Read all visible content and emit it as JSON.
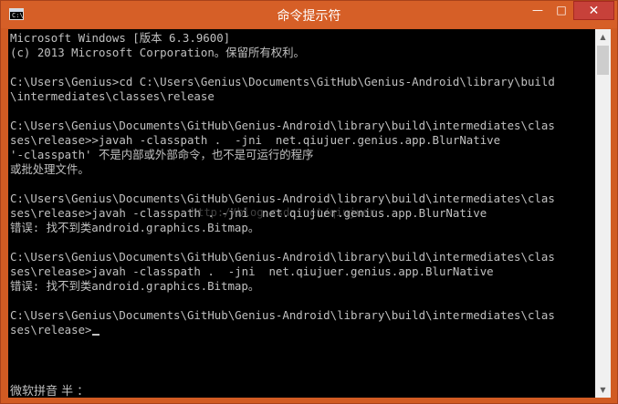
{
  "window": {
    "title": "命令提示符",
    "icon_label": "C:\\",
    "minimize_symbol": "—",
    "maximize_symbol": "□",
    "close_symbol": "✕"
  },
  "console": {
    "lines": [
      "Microsoft Windows [版本 6.3.9600]",
      "(c) 2013 Microsoft Corporation。保留所有权利。",
      "",
      "C:\\Users\\Genius>cd C:\\Users\\Genius\\Documents\\GitHub\\Genius-Android\\library\\build",
      "\\intermediates\\classes\\release",
      "",
      "C:\\Users\\Genius\\Documents\\GitHub\\Genius-Android\\library\\build\\intermediates\\clas",
      "ses\\release>>javah -classpath .  -jni  net.qiujuer.genius.app.BlurNative",
      "'-classpath' 不是内部或外部命令，也不是可运行的程序",
      "或批处理文件。",
      "",
      "C:\\Users\\Genius\\Documents\\GitHub\\Genius-Android\\library\\build\\intermediates\\clas",
      "ses\\release>javah -classpath . -jni  net.qiujuer.genius.app.BlurNative",
      "错误: 找不到类android.graphics.Bitmap。",
      "",
      "C:\\Users\\Genius\\Documents\\GitHub\\Genius-Android\\library\\build\\intermediates\\clas",
      "ses\\release>javah -classpath .  -jni  net.qiujuer.genius.app.BlurNative",
      "错误: 找不到类android.graphics.Bitmap。",
      "",
      "C:\\Users\\Genius\\Documents\\GitHub\\Genius-Android\\library\\build\\intermediates\\clas",
      "ses\\release>"
    ],
    "watermark": "http://blog.csdn.net/qiujuer",
    "ime_status": "微软拼音 半 ："
  },
  "colors": {
    "titlebar": "#d65f27",
    "console_bg": "#000000",
    "console_text": "#c0c0c0",
    "close_button": "#c7413a"
  },
  "icons": {
    "app": "console-app-icon",
    "scroll_up": "scroll-up-arrow-icon",
    "scroll_down": "scroll-down-arrow-icon"
  }
}
